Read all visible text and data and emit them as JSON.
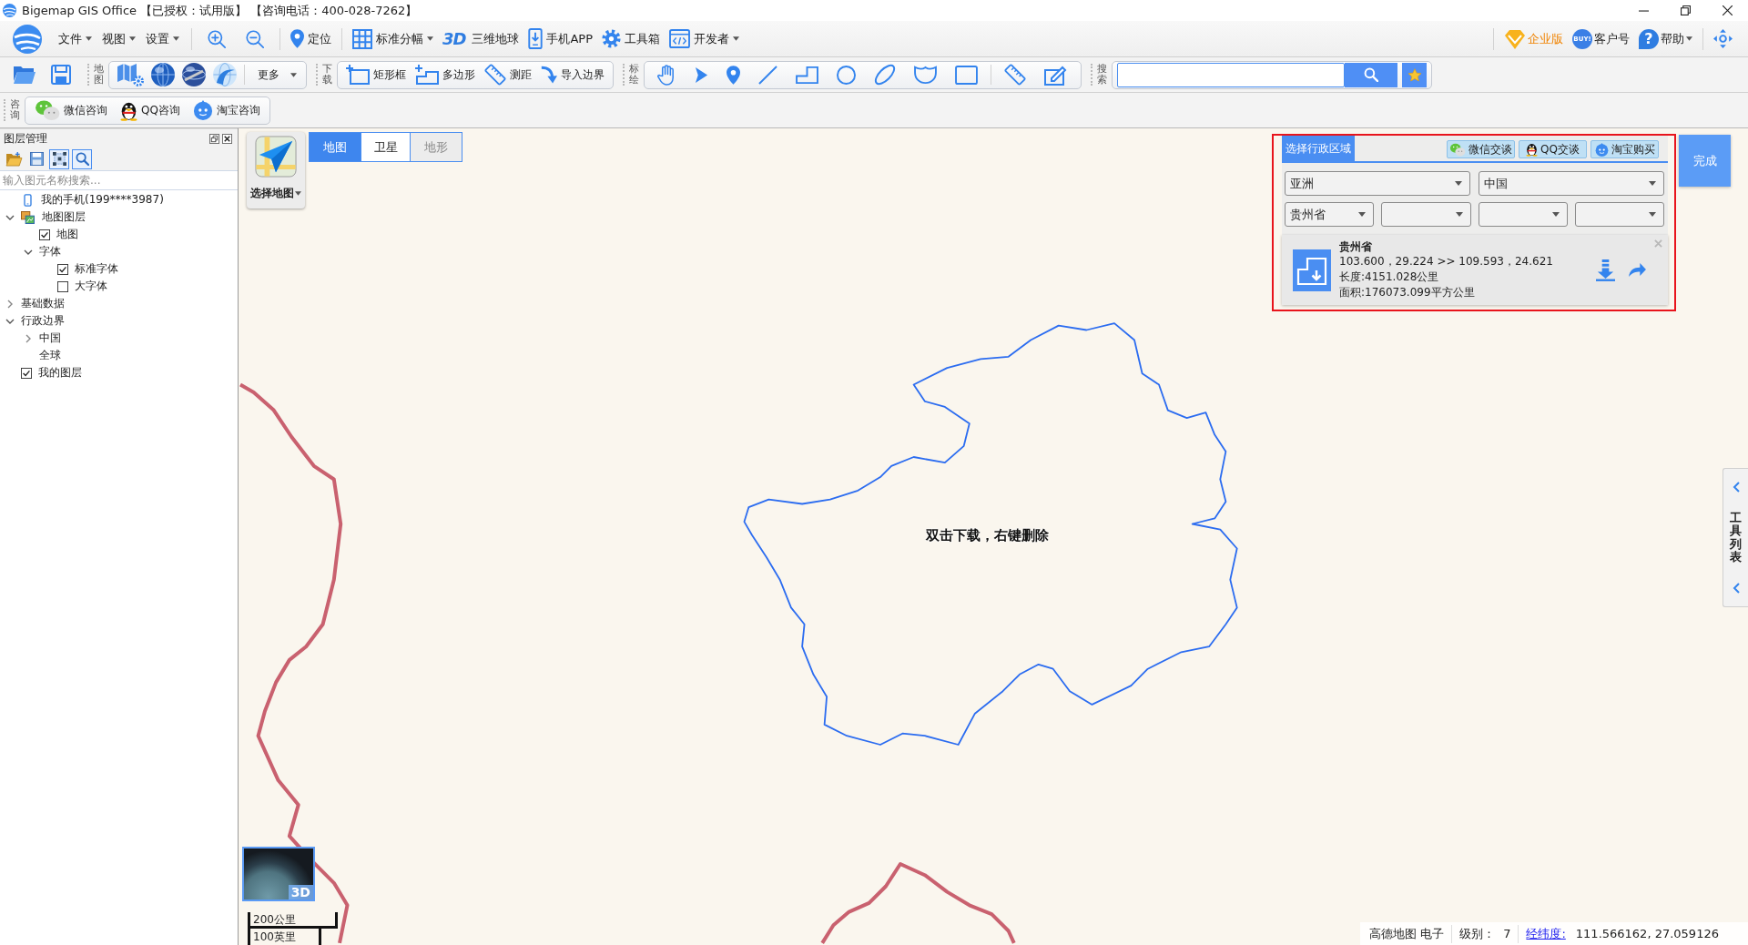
{
  "window": {
    "title": "Bigemap GIS Office 【已授权：试用版】 【咨询电话：400-028-7262】"
  },
  "menu_bar": {
    "left": [
      [
        {
          "label": "文件",
          "dropdown": true
        },
        {
          "label": "视图",
          "dropdown": true
        },
        {
          "label": "设置",
          "dropdown": true
        }
      ],
      [
        {
          "dropdown": false
        },
        {
          "dropdown": false
        }
      ],
      [
        {
          "label": "定位",
          "dropdown": false
        }
      ],
      [
        {
          "label": "标准分幅",
          "dropdown": true
        },
        {
          "icon_text": "3D",
          "label": "三维地球",
          "dropdown": false
        },
        {
          "label": "手机APP",
          "dropdown": false
        },
        {
          "label": "工具箱",
          "dropdown": false
        },
        {
          "label": "开发者",
          "dropdown": true
        }
      ]
    ],
    "right": [
      [
        {
          "label": "企业版",
          "color": "#f08300",
          "dropdown": false
        },
        {
          "icon_text": "BUY!",
          "label": "客户号",
          "dropdown": false
        },
        {
          "icon_text": "?",
          "label": "帮助",
          "dropdown": true
        }
      ],
      [
        {
          "dropdown": false
        }
      ]
    ]
  },
  "toolbar": {
    "quick": [
      {
        "dropdown": false
      },
      {
        "dropdown": false
      }
    ],
    "groups": [
      {
        "title": "地图",
        "kind": "buttons",
        "sets": [
          [
            {
              "dropdown": false
            },
            {
              "dropdown": false
            },
            {
              "dropdown": false
            },
            {
              "dropdown": false
            }
          ],
          [
            {
              "label": "更多",
              "dropdown": true
            }
          ]
        ]
      },
      {
        "title": "下载",
        "kind": "buttons",
        "sets": [
          [
            {
              "label": "矩形框",
              "dropdown": false
            },
            {
              "label": "多边形",
              "dropdown": false
            },
            {
              "label": "测距",
              "dropdown": false
            },
            {
              "label": "导入边界",
              "dropdown": false
            }
          ]
        ]
      },
      {
        "title": "标绘",
        "kind": "buttons",
        "sets": [
          [
            {
              "dropdown": false
            },
            {
              "dropdown": false
            },
            {
              "dropdown": false
            },
            {
              "dropdown": false
            },
            {
              "dropdown": false
            },
            {
              "dropdown": false
            },
            {
              "dropdown": false
            },
            {
              "dropdown": false
            },
            {
              "dropdown": false
            }
          ],
          [
            {
              "dropdown": false
            },
            {
              "dropdown": false
            }
          ]
        ]
      },
      {
        "title": "搜索",
        "kind": "search"
      }
    ]
  },
  "consult_bar": {
    "title": "咨询",
    "buttons": [
      {
        "label": "微信咨询"
      },
      {
        "label": "QQ咨询"
      },
      {
        "label": "淘宝咨询"
      }
    ]
  },
  "layer_panel": {
    "title": "图层管理",
    "tools": [
      {
        "selected": false
      },
      {
        "selected": false
      },
      {
        "selected": true
      },
      {
        "selected": true
      }
    ],
    "search": {
      "placeholder": "输入图元名称搜索..."
    },
    "tree": [
      {
        "kind": "phone",
        "label": "我的手机(199****3987)"
      },
      {
        "kind": "layers",
        "label": "地图图层",
        "expanded": true,
        "children": [
          {
            "kind": "checkbox",
            "label": "地图",
            "checked": true
          },
          {
            "kind": "group",
            "label": "字体",
            "expanded": true,
            "children": [
              {
                "kind": "checkbox",
                "label": "标准字体",
                "checked": true
              },
              {
                "kind": "checkbox",
                "label": "大字体",
                "checked": false
              }
            ]
          }
        ]
      },
      {
        "kind": "group",
        "label": "基础数据",
        "expanded": false
      },
      {
        "kind": "group",
        "label": "行政边界",
        "expanded": true,
        "children": [
          {
            "kind": "group",
            "label": "中国",
            "expanded": false
          },
          {
            "kind": "group",
            "label": "全球"
          }
        ]
      },
      {
        "kind": "checkbox",
        "label": "我的图层",
        "checked": true
      }
    ]
  },
  "map": {
    "picker": {
      "label": "选择地图",
      "dropdown": true
    },
    "tabs": [
      {
        "label": "地图",
        "selected": true,
        "disabled": false
      },
      {
        "label": "卫星",
        "selected": false,
        "disabled": false
      },
      {
        "label": "地形",
        "selected": false,
        "disabled": true
      }
    ],
    "hint": "双击下载，右键删除",
    "globe_button": "3D",
    "scale": [
      "200公里",
      "100英里"
    ],
    "status": {
      "source": "高德地图 电子",
      "zoom_label": "级别：",
      "zoom_value": "7",
      "coords_label": "经纬度:",
      "coords": "111.566162, 27.059126"
    }
  },
  "region_panel": {
    "tab": "选择行政区域",
    "buttons": [
      {
        "label": "微信交谈"
      },
      {
        "label": "QQ交谈"
      },
      {
        "label": "淘宝购买"
      }
    ],
    "select_rows": [
      [
        {
          "value": "亚洲",
          "expanded": false
        },
        {
          "value": "中国",
          "expanded": false
        }
      ],
      [
        {
          "value": "贵州省",
          "expanded": false
        },
        {
          "expanded": false
        },
        {
          "expanded": false
        },
        {
          "expanded": false
        }
      ]
    ],
    "result": {
      "name": "贵州省",
      "bounds": "103.600，29.224 >> 109.593，24.621",
      "length": "长度:4151.028公里",
      "area": "面积:176073.099平方公里"
    },
    "done_button": "完成"
  },
  "side_panel": {
    "label": "工具列表"
  }
}
